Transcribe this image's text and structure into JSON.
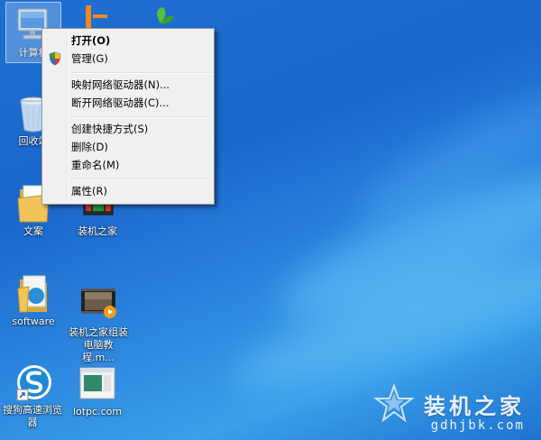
{
  "desktop": {
    "icons": [
      {
        "label": "计算机"
      },
      {
        "label": "回收站"
      },
      {
        "label": "文案"
      },
      {
        "label": "software"
      },
      {
        "label": "搜狗高速浏览器"
      },
      {
        "label": "装机之家"
      },
      {
        "label": "装机之家组装电脑教程.m..."
      },
      {
        "label": "lotpc.com"
      }
    ]
  },
  "context_menu": {
    "items": [
      {
        "label": "打开(O)"
      },
      {
        "label": "管理(G)"
      },
      {
        "label": "映射网络驱动器(N)..."
      },
      {
        "label": "断开网络驱动器(C)..."
      },
      {
        "label": "创建快捷方式(S)"
      },
      {
        "label": "删除(D)"
      },
      {
        "label": "重命名(M)"
      },
      {
        "label": "属性(R)"
      }
    ]
  },
  "watermark": {
    "title": "装机之家",
    "url": "gdhjbk.com"
  },
  "colors": {
    "desktop_blue": "#1f6fd3",
    "menu_bg": "#f0f0f0"
  }
}
